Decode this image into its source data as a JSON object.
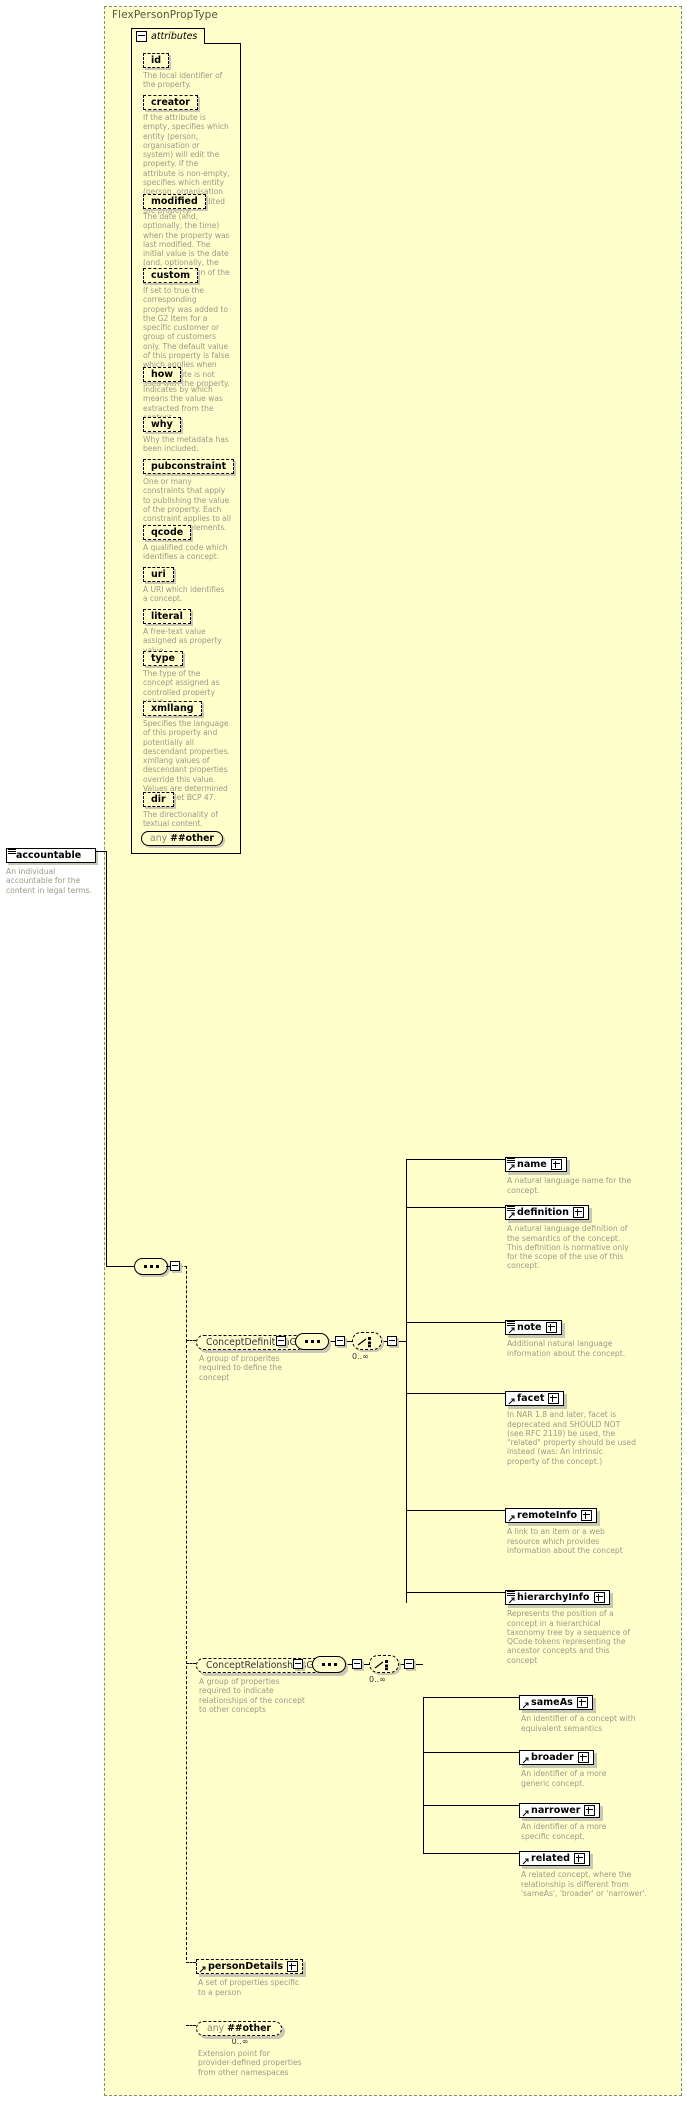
{
  "type": {
    "name": "FlexPersonPropType"
  },
  "attributes_section": {
    "label": "attributes",
    "toggle": "minus-icon",
    "items": [
      {
        "name": "id",
        "desc": "The local identifier of the property."
      },
      {
        "name": "creator",
        "desc": "If the attribute is empty, specifies which entity (person, organisation or system) will edit the property. If the attribute is non-empty, specifies which entity (person, organisation or system) has edited the property."
      },
      {
        "name": "modified",
        "desc": "The date (and, optionally, the time) when the property was last modified. The initial value is the date (and, optionally, the time) of creation of the property."
      },
      {
        "name": "custom",
        "desc": "If set to true the corresponding property was added to the G2 Item for a specific customer or group of customers only. The default value of this property is false which applies when this attribute is not used with the property."
      },
      {
        "name": "how",
        "desc": "Indicates by which means the value was extracted from the content."
      },
      {
        "name": "why",
        "desc": "Why the metadata has been included."
      },
      {
        "name": "pubconstraint",
        "desc": "One or many constraints that apply to publishing the value of the property. Each constraint applies to all descendant elements."
      },
      {
        "name": "qcode",
        "desc": "A qualified code which identifies a concept."
      },
      {
        "name": "uri",
        "desc": "A URI which identifies a concept."
      },
      {
        "name": "literal",
        "desc": "A free-text value assigned as property value."
      },
      {
        "name": "type",
        "desc": "The type of the concept assigned as controlled property value."
      },
      {
        "name": "xmllang",
        "desc": "Specifies the language of this property and potentially all descendant properties. xmllang values of descendant properties override this value. Values are determined by Internet BCP 47."
      },
      {
        "name": "dir",
        "desc": "The directionality of textual content."
      }
    ],
    "any": {
      "prefix": "any",
      "ns": "##other"
    }
  },
  "accountable": {
    "name": "accountable",
    "desc": "An individual accountable for the content in legal terms."
  },
  "groups": [
    {
      "name": "ConceptDefinitionGroup",
      "desc": "A group of properites required to define the concept",
      "compositor": "sequence",
      "choice_mult": "0..∞",
      "children": [
        {
          "name": "name",
          "has_attrs": true,
          "expand": "plus-icon",
          "desc": "A natural language name for the concept."
        },
        {
          "name": "definition",
          "has_attrs": true,
          "expand": "plus-icon",
          "desc": "A natural language definition of the semantics of the concept. This definition is normative only for the scope of the use of this concept."
        },
        {
          "name": "note",
          "has_attrs": true,
          "expand": "plus-icon",
          "desc": "Additional natural language information about the concept."
        },
        {
          "name": "facet",
          "has_attrs": false,
          "expand": "plus-icon",
          "desc": "In NAR 1.8 and later, facet is deprecated and SHOULD NOT (see RFC 2119) be used, the \"related\" property should be used instead (was: An intrinsic property of the concept.)"
        },
        {
          "name": "remoteInfo",
          "has_attrs": false,
          "expand": "plus-icon",
          "desc": "A link to an item or a web resource which provides information about the concept"
        },
        {
          "name": "hierarchyInfo",
          "has_attrs": true,
          "expand": "plus-icon",
          "desc": "Represents the position of a concept in a hierarchical taxonomy tree by a sequence of QCode tokens representing the ancestor concepts and this concept"
        }
      ]
    },
    {
      "name": "ConceptRelationshipsGroup",
      "desc": "A group of properties required to indicate relationships of the concept to other concepts",
      "compositor": "sequence",
      "choice_mult": "0..∞",
      "children": [
        {
          "name": "sameAs",
          "has_attrs": false,
          "expand": "plus-icon",
          "desc": "An identifier of a concept with equivalent semantics"
        },
        {
          "name": "broader",
          "has_attrs": false,
          "expand": "plus-icon",
          "desc": "An identifier of a more generic concept."
        },
        {
          "name": "narrower",
          "has_attrs": false,
          "expand": "plus-icon",
          "desc": "An identifier of a more specific concept."
        },
        {
          "name": "related",
          "has_attrs": false,
          "expand": "plus-icon",
          "desc": "A related concept, where the relationship is different from 'sameAs', 'broader' or 'narrower'."
        }
      ]
    }
  ],
  "tail": {
    "person_details": {
      "name": "personDetails",
      "expand": "plus-icon",
      "desc": "A set of properties specific to a person"
    },
    "any_other": {
      "prefix": "any",
      "ns": "##other",
      "mult": "0..∞",
      "desc": "Extension point for provider-defined properties from other namespaces"
    }
  },
  "colors": {
    "frame_bg": "#ffffcc",
    "frame_border": "#8a8a7a",
    "desc_text": "#9a9a8a",
    "shadow": "#c8c8b4",
    "ink": "#000000"
  }
}
